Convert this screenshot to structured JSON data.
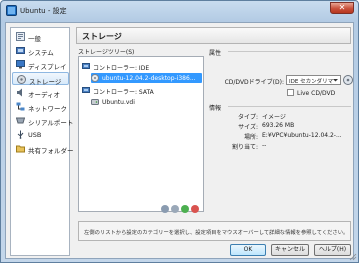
{
  "window": {
    "title": "Ubuntu - 設定",
    "close_glyph": "✕"
  },
  "nav": {
    "items": [
      {
        "label": "一般",
        "icon": "general-icon"
      },
      {
        "label": "システム",
        "icon": "system-icon"
      },
      {
        "label": "ディスプレイ",
        "icon": "display-icon"
      },
      {
        "label": "ストレージ",
        "icon": "storage-icon",
        "selected": true
      },
      {
        "label": "オーディオ",
        "icon": "audio-icon"
      },
      {
        "label": "ネットワーク",
        "icon": "network-icon"
      },
      {
        "label": "シリアルポート",
        "icon": "serial-port-icon"
      },
      {
        "label": "USB",
        "icon": "usb-icon"
      },
      {
        "label": "共有フォルダー",
        "icon": "shared-folder-icon"
      }
    ]
  },
  "header": {
    "title": "ストレージ"
  },
  "storage_tree": {
    "label": "ストレージツリー(S)",
    "controllers": [
      {
        "label": "コントローラー: IDE",
        "attachments": [
          "ubuntu-12.04.2-desktop-i386..."
        ]
      },
      {
        "label": "コントローラー: SATA",
        "attachments": [
          "Ubuntu.vdi"
        ]
      }
    ]
  },
  "attributes": {
    "heading": "属性",
    "drive_label": "CD/DVDドライブ(D):",
    "drive_value": "IDE セカンダリマスター",
    "live_label": "Live CD/DVD"
  },
  "info": {
    "heading": "情報",
    "rows": [
      {
        "label": "タイプ:",
        "value": "イメージ"
      },
      {
        "label": "サイズ:",
        "value": "693.26 MB"
      },
      {
        "label": "場所:",
        "value": "E:¥VPC¥ubuntu-12.04.2-..."
      },
      {
        "label": "割り当て:",
        "value": "--"
      }
    ]
  },
  "hint": "左側のリストから設定のカテゴリーを選択し、設定項目をマウスオーバーして詳細な情報を参照してください。",
  "buttons": {
    "ok": "OK",
    "cancel": "キャンセル",
    "help": "ヘルプ(H)"
  },
  "colors": {
    "accent": "#3399ff",
    "title_bar": "#b9cfe6",
    "close": "#c9503b"
  }
}
